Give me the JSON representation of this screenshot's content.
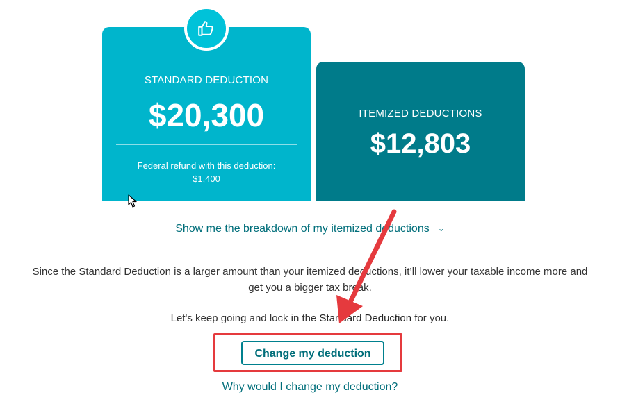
{
  "standard_card": {
    "label": "STANDARD DEDUCTION",
    "amount": "$20,300",
    "refund_label": "Federal refund with this deduction:",
    "refund_value": "$1,400",
    "badge_icon": "thumbs-up-icon",
    "color": "#00b5cc"
  },
  "itemized_card": {
    "label": "ITEMIZED DEDUCTIONS",
    "amount": "$12,803",
    "color": "#007b8a"
  },
  "breakdown_link": {
    "label": "Show me the breakdown of my itemized deductions",
    "icon": "chevron-down-icon"
  },
  "explanation": {
    "line1": "Since the Standard Deduction is a larger amount than your itemized deductions, it’ll lower your taxable income more and",
    "line2": "get you a bigger tax break."
  },
  "keep_going": {
    "prefix": "Let's keep going and lock in the ",
    "emphasis": "Standard Deduction",
    "suffix": " for you."
  },
  "change_button": {
    "label": "Change my deduction"
  },
  "why_link": {
    "label": "Why would I change my deduction?"
  },
  "annotation": {
    "arrow_color": "#e53a3e",
    "box_color": "#e53a3e"
  }
}
